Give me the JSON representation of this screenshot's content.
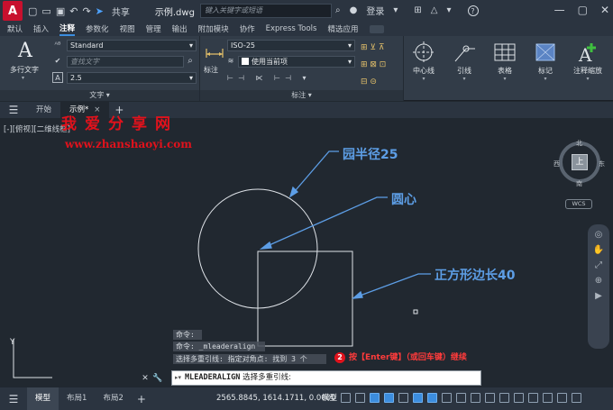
{
  "titlebar": {
    "logo": "A",
    "share": "共享",
    "filename": "示例.dwg",
    "search_placeholder": "键入关键字或短语",
    "login": "登录",
    "help": "?"
  },
  "ribbon_tabs": [
    "默认",
    "插入",
    "注释",
    "参数化",
    "视图",
    "管理",
    "输出",
    "附加模块",
    "协作",
    "Express Tools",
    "精选应用"
  ],
  "active_tab": "注释",
  "ribbon": {
    "text_group": {
      "label": "文字",
      "multiline_text": "多行文字",
      "style": "Standard",
      "find_placeholder": "查找文字",
      "height": "2.5"
    },
    "dim_group": {
      "label": "标注",
      "dim_button": "标注",
      "dim_style": "ISO-25",
      "use_current": "使用当前项"
    },
    "tools": [
      {
        "label": "中心线"
      },
      {
        "label": "引线"
      },
      {
        "label": "表格"
      },
      {
        "label": "标记"
      },
      {
        "label": "注释缩放"
      }
    ]
  },
  "file_tabs": [
    {
      "label": "开始",
      "active": false
    },
    {
      "label": "示例*",
      "active": true
    }
  ],
  "viewport": {
    "label": "[-][俯视][二维线框]",
    "watermark_title": "我爱分享网",
    "watermark_url": "www.zhanshaoyi.com",
    "annotations": {
      "radius": "园半径25",
      "center": "圆心",
      "square": "正方形边长40"
    },
    "viewcube": {
      "face": "上",
      "north": "北",
      "south": "南",
      "east": "东",
      "west": "西",
      "wcs": "WCS"
    }
  },
  "command": {
    "history": [
      "命令:",
      "命令: _mleaderalign",
      "选择多重引线: 指定对角点: 找到 3 个"
    ],
    "prompt_cmd": "MLEADERALIGN",
    "prompt_text": "选择多重引线:",
    "note_number": "2",
    "note_text": "按【Enter键】（或回车键）继续"
  },
  "statusbar": {
    "tabs": [
      {
        "label": "模型",
        "active": true
      },
      {
        "label": "布局1",
        "active": false
      },
      {
        "label": "布局2",
        "active": false
      }
    ],
    "coords": "2565.8845, 1614.1711, 0.0000",
    "model": "模型"
  },
  "colors": {
    "viewport_bg": "#212830",
    "annotation_blue": "#5d9ee6",
    "note_red": "#ff3b3b"
  }
}
